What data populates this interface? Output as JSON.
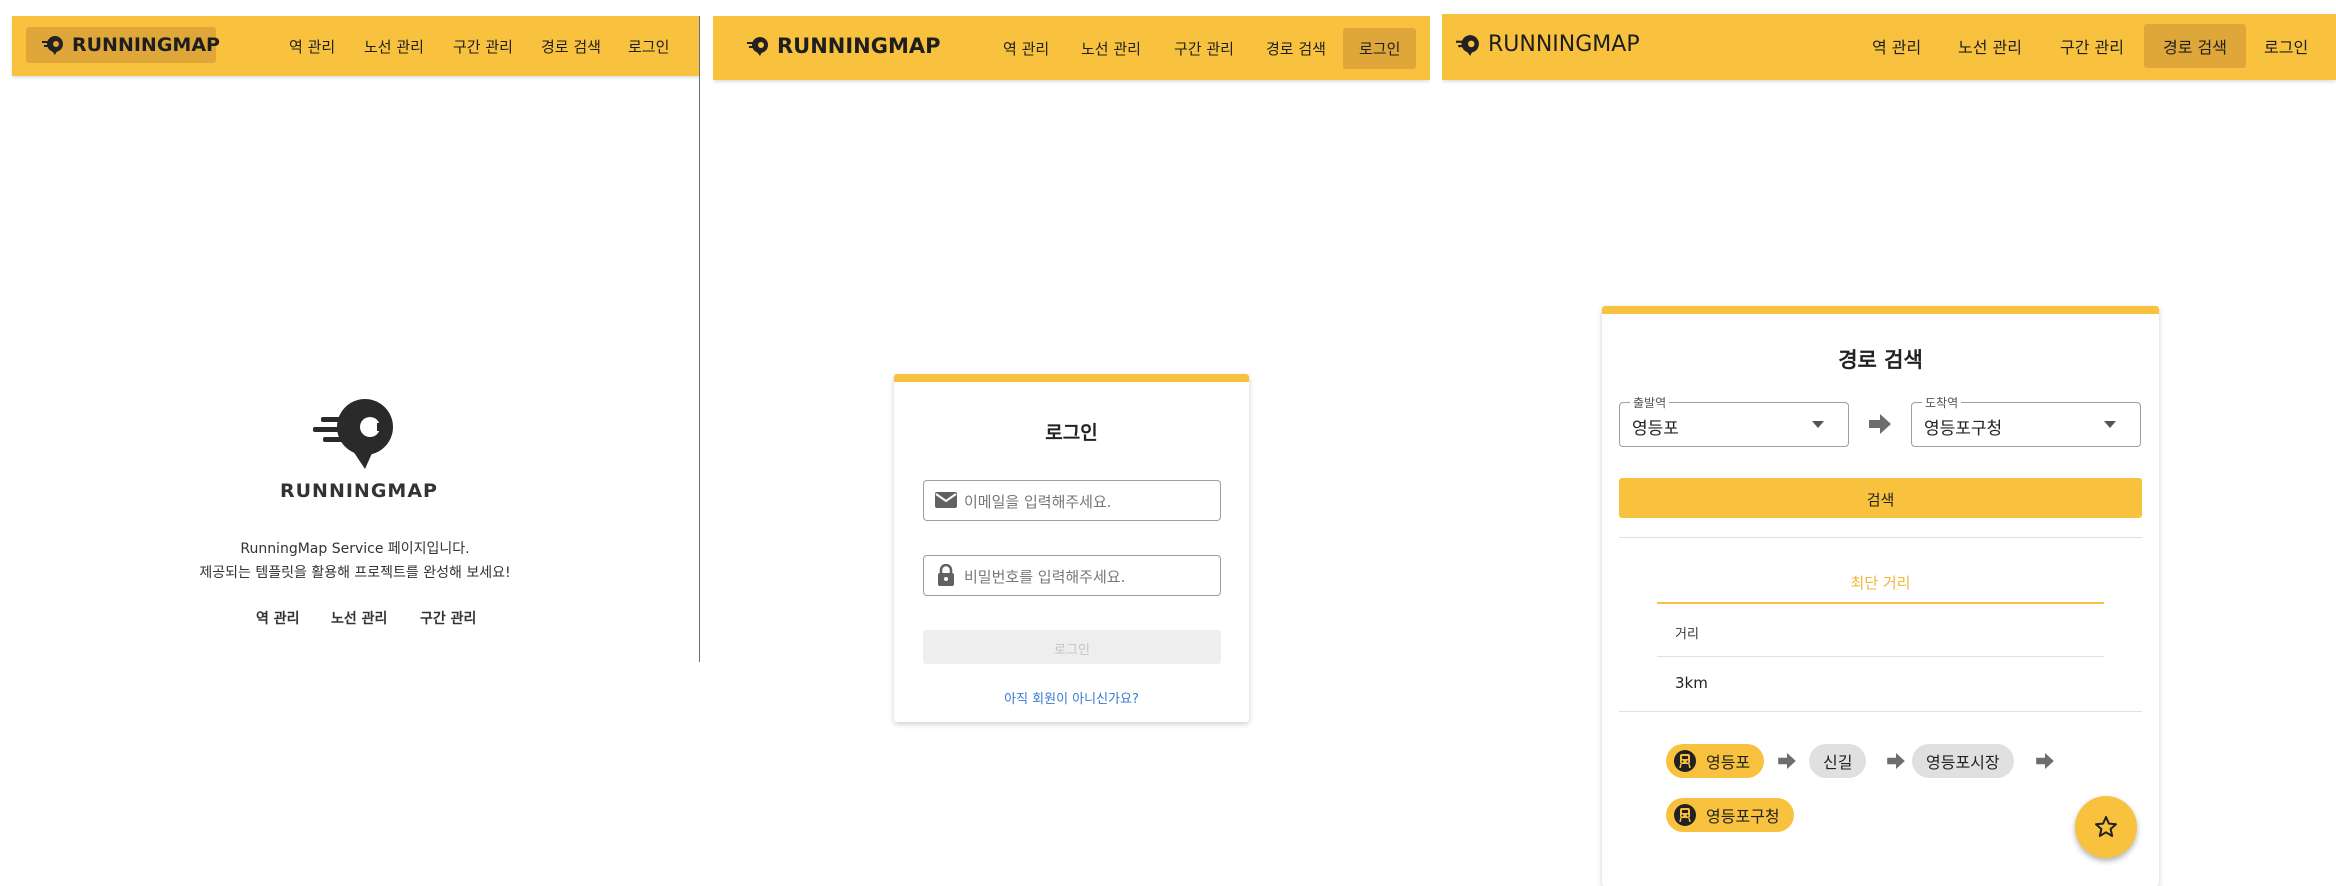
{
  "brand": {
    "name": "RUNNINGMAP",
    "accent": "#f8c23f"
  },
  "nav": {
    "items": [
      {
        "label": "역 관리"
      },
      {
        "label": "노선 관리"
      },
      {
        "label": "구간 관리"
      },
      {
        "label": "경로 검색"
      },
      {
        "label": "로그인"
      }
    ]
  },
  "home": {
    "logo_text": "RUNNINGMAP",
    "intro_line1": "RunningMap Service 페이지입니다.",
    "intro_line2": "제공되는 템플릿을 활용해 프로젝트를 완성해 보세요!",
    "links": [
      {
        "label": "역 관리"
      },
      {
        "label": "노선 관리"
      },
      {
        "label": "구간 관리"
      }
    ]
  },
  "login": {
    "title": "로그인",
    "email_placeholder": "이메일을 입력해주세요.",
    "password_placeholder": "비밀번호를 입력해주세요.",
    "submit_label": "로그인",
    "signup_link": "아직 회원이 아니신가요?",
    "icons": {
      "email": "mail-icon",
      "password": "lock-icon"
    }
  },
  "path": {
    "title": "경로 검색",
    "source_label": "출발역",
    "source_value": "영등포",
    "target_label": "도착역",
    "target_value": "영등포구청",
    "search_label": "검색",
    "tab_label": "최단 거리",
    "distance_header": "거리",
    "distance_value": "3km",
    "stations": [
      {
        "name": "영등포",
        "style": "endpoint",
        "icon": "train-icon"
      },
      {
        "name": "신길",
        "style": "middle"
      },
      {
        "name": "영등포시장",
        "style": "middle"
      },
      {
        "name": "영등포구청",
        "style": "endpoint",
        "icon": "train-icon"
      }
    ],
    "fab_icon": "star-outline-icon"
  }
}
